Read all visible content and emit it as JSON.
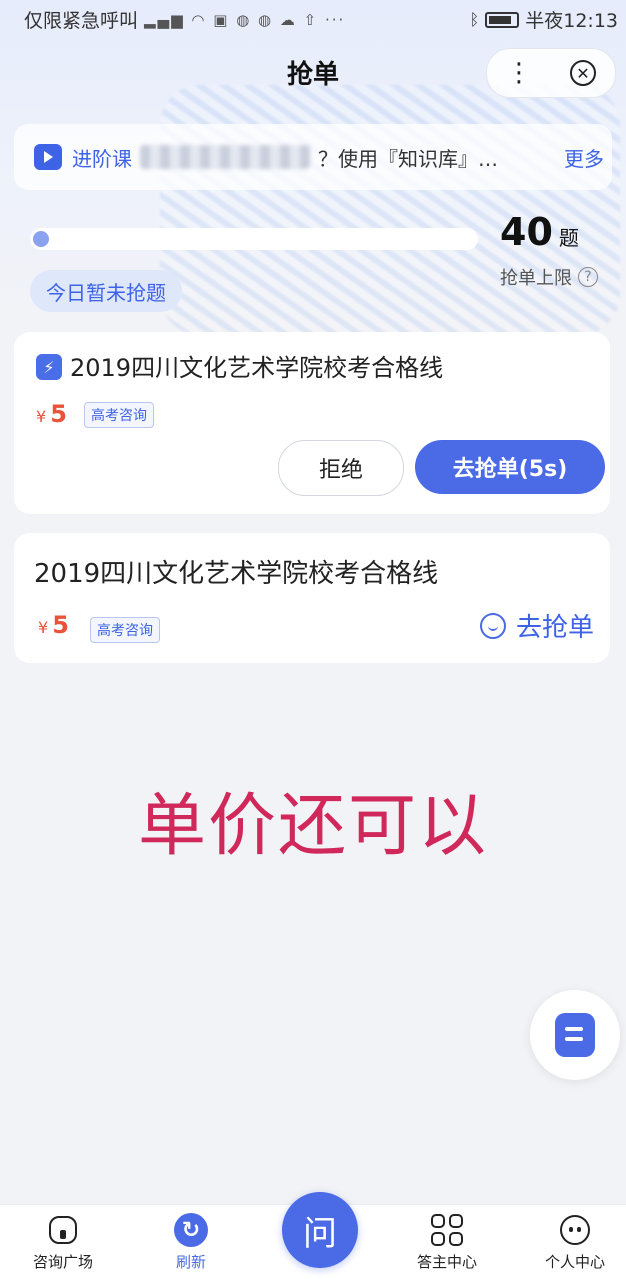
{
  "status_bar": {
    "left_text": "仅限紧急呼叫",
    "icons": [
      "signal-icon",
      "wifi-icon",
      "battery-saver-icon",
      "app-icon",
      "app-icon",
      "cloud-icon",
      "upload-icon",
      "more-icon"
    ],
    "time": "半夜12:13"
  },
  "header": {
    "title": "抢单",
    "menu_glyph": "⋮",
    "close_glyph": "✕"
  },
  "notice": {
    "tag": "进阶课",
    "text": "？使用『知识库』…",
    "more": "更多"
  },
  "quota": {
    "progress_fraction": 0.03,
    "count": "40",
    "unit": "题",
    "limit_label": "抢单上限",
    "help_glyph": "?",
    "today_status": "今日暂未抢题"
  },
  "cards": [
    {
      "icon_glyph": "⚡",
      "title": "2019四川文化艺术学院校考合格线",
      "currency": "¥",
      "price": "5",
      "tag": "高考咨询",
      "reject_label": "拒绝",
      "grab_label": "去抢单(5s)"
    },
    {
      "title": "2019四川文化艺术学院校考合格线",
      "currency": "¥",
      "price": "5",
      "tag": "高考咨询",
      "grab_label": "去抢单"
    }
  ],
  "overlay_caption": "单价还可以",
  "bottom_nav": {
    "items": [
      {
        "label": "咨询广场",
        "icon": "home-icon"
      },
      {
        "label": "刷新",
        "icon": "refresh-icon"
      },
      {
        "label": "答主中心",
        "icon": "grid-icon"
      },
      {
        "label": "个人中心",
        "icon": "person-icon"
      }
    ],
    "center_label": "问"
  },
  "colors": {
    "accent": "#4a6ae6",
    "price": "#e8533a",
    "caption": "#d0285a"
  }
}
